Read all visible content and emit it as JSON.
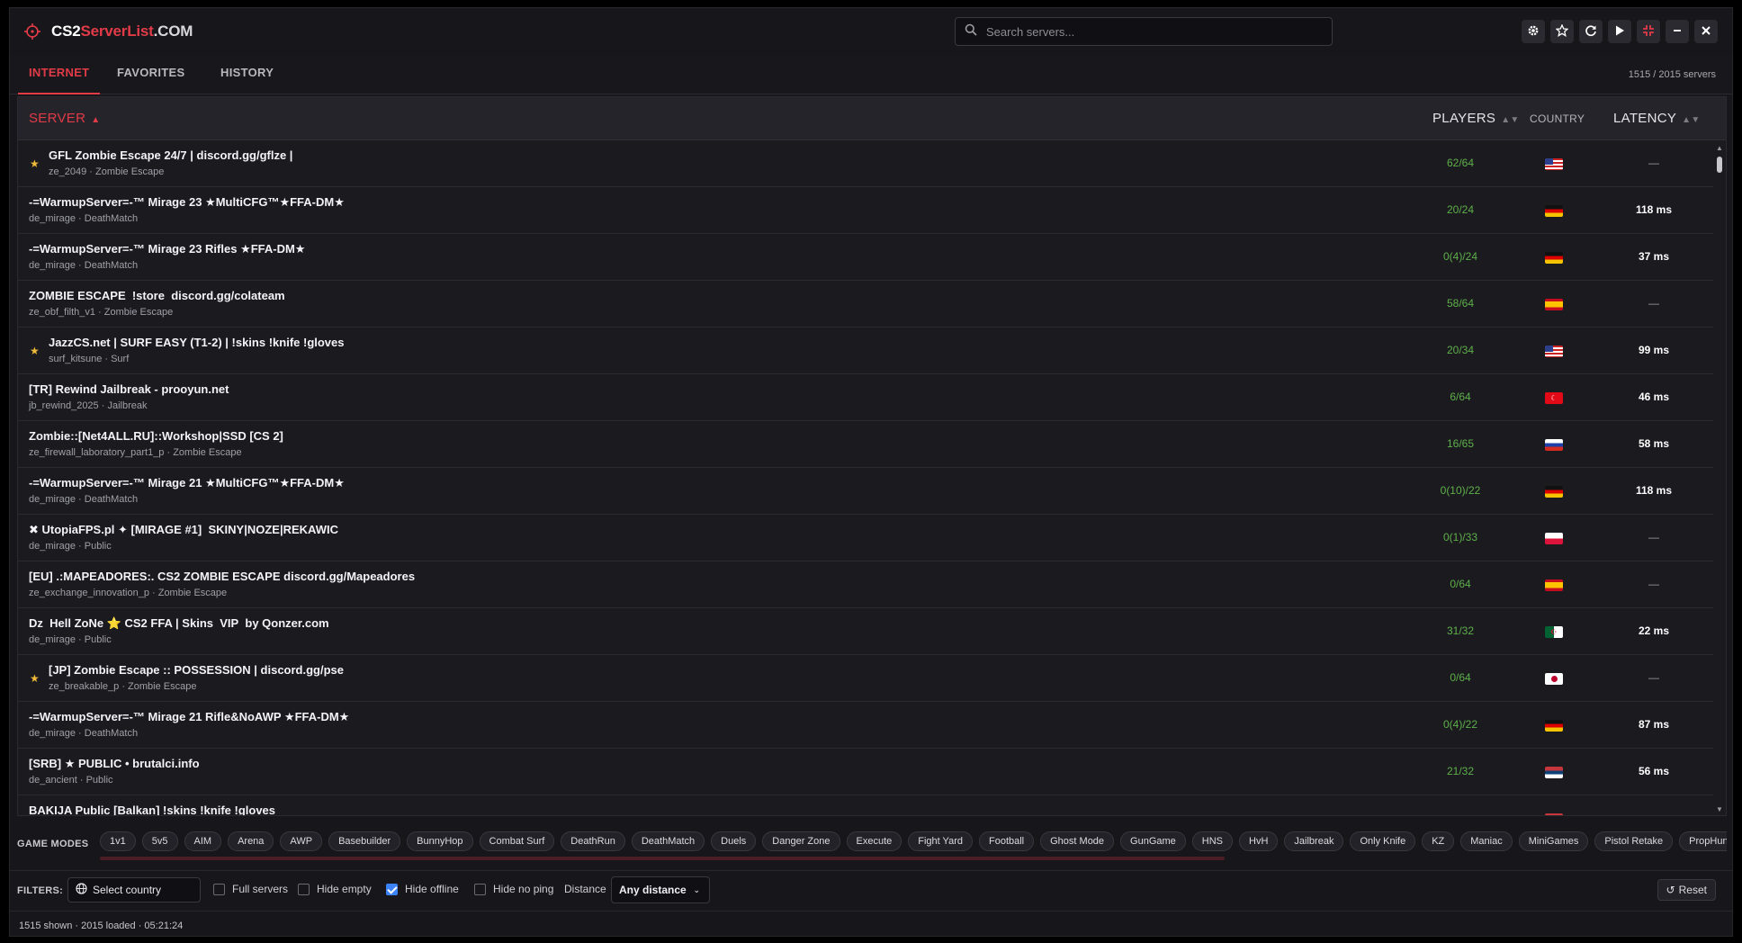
{
  "header": {
    "logo_a": "CS2",
    "logo_b": "ServerList",
    "logo_c": ".COM",
    "search_placeholder": "Search servers...",
    "window_buttons": [
      "settings-icon",
      "star-icon",
      "refresh-icon",
      "play-icon",
      "compress-icon",
      "minimize-icon",
      "close-icon"
    ]
  },
  "tabs": [
    {
      "label": "INTERNET",
      "active": true
    },
    {
      "label": "FAVORITES",
      "active": false
    },
    {
      "label": "HISTORY",
      "active": false
    }
  ],
  "server_count": "1515 / 2015 servers",
  "columns": {
    "server": "SERVER",
    "players": "PLAYERS",
    "country": "COUNTRY",
    "latency": "LATENCY"
  },
  "rows": [
    {
      "fav": true,
      "name": "GFL Zombie Escape 24/7 | discord.gg/gflze |",
      "map": "ze_2049 · Zombie Escape",
      "players": "62/64",
      "country": "US",
      "latency": "—"
    },
    {
      "fav": false,
      "name": "-=WarmupServer=-™ Mirage 23 ★MultiCFG™★FFA-DM★",
      "map": "de_mirage · DeathMatch",
      "players": "20/24",
      "country": "DE",
      "latency": "118 ms"
    },
    {
      "fav": false,
      "name": "-=WarmupServer=-™ Mirage 23 Rifles ★FFA-DM★",
      "map": "de_mirage · DeathMatch",
      "players": "0(4)/24",
      "country": "DE",
      "latency": "37 ms"
    },
    {
      "fav": false,
      "name": "ZOMBIE ESCAPE  !store  discord.gg/colateam",
      "map": "ze_obf_filth_v1 · Zombie Escape",
      "players": "58/64",
      "country": "ES",
      "latency": "—"
    },
    {
      "fav": true,
      "name": "JazzCS.net | SURF EASY (T1-2) | !skins !knife !gloves",
      "map": "surf_kitsune · Surf",
      "players": "20/34",
      "country": "US",
      "latency": "99 ms"
    },
    {
      "fav": false,
      "name": "[TR] Rewind Jailbreak - prooyun.net",
      "map": "jb_rewind_2025 · Jailbreak",
      "players": "6/64",
      "country": "TR",
      "latency": "46 ms"
    },
    {
      "fav": false,
      "name": "Zombie::[Net4ALL.RU]::Workshop|SSD [CS 2]",
      "map": "ze_firewall_laboratory_part1_p · Zombie Escape",
      "players": "16/65",
      "country": "RU",
      "latency": "58 ms"
    },
    {
      "fav": false,
      "name": "-=WarmupServer=-™ Mirage 21 ★MultiCFG™★FFA-DM★",
      "map": "de_mirage · DeathMatch",
      "players": "0(10)/22",
      "country": "DE",
      "latency": "118 ms"
    },
    {
      "fav": false,
      "name": "✖ UtopiaFPS.pl ✦ [MIRAGE #1]  SKINY|NOZE|REKAWIC",
      "map": "de_mirage · Public",
      "players": "0(1)/33",
      "country": "PL",
      "latency": "—"
    },
    {
      "fav": false,
      "name": "[EU] .:MAPEADORES:. CS2 ZOMBIE ESCAPE discord.gg/Mapeadores",
      "map": "ze_exchange_innovation_p · Zombie Escape",
      "players": "0/64",
      "country": "ES",
      "latency": "—"
    },
    {
      "fav": false,
      "name": "Dz  Hell ZoNe ⭐ CS2 FFA | Skins  VIP  by Qonzer.com",
      "map": "de_mirage · Public",
      "players": "31/32",
      "country": "DZ",
      "latency": "22 ms"
    },
    {
      "fav": true,
      "name": "[JP] Zombie Escape :: POSSESSION | discord.gg/pse",
      "map": "ze_breakable_p · Zombie Escape",
      "players": "0/64",
      "country": "JP",
      "latency": "—"
    },
    {
      "fav": false,
      "name": "-=WarmupServer=-™ Mirage 21 Rifle&NoAWP ★FFA-DM★",
      "map": "de_mirage · DeathMatch",
      "players": "0(4)/22",
      "country": "DE",
      "latency": "87 ms"
    },
    {
      "fav": false,
      "name": "[SRB] ★ PUBLIC • brutalci.info",
      "map": "de_ancient · Public",
      "players": "21/32",
      "country": "RS",
      "latency": "56 ms"
    },
    {
      "fav": false,
      "name": "BAKIJA Public [Balkan] !skins !knife !gloves",
      "map": "",
      "players": "",
      "country": "RS",
      "latency": ""
    }
  ],
  "game_modes": {
    "label": "GAME MODES",
    "chips": [
      "1v1",
      "5v5",
      "AIM",
      "Arena",
      "AWP",
      "Basebuilder",
      "BunnyHop",
      "Combat Surf",
      "DeathRun",
      "DeathMatch",
      "Duels",
      "Danger Zone",
      "Execute",
      "Fight Yard",
      "Football",
      "Ghost Mode",
      "GunGame",
      "HNS",
      "HvH",
      "Jailbreak",
      "Only Knife",
      "KZ",
      "Maniac",
      "MiniGames",
      "Pistol Retake",
      "PropHunt"
    ]
  },
  "filters": {
    "label": "FILTERS:",
    "country_placeholder": "Select country",
    "full_servers": "Full servers",
    "hide_empty": "Hide empty",
    "hide_offline": "Hide offline",
    "hide_no_ping": "Hide no ping",
    "distance_label": "Distance",
    "distance_value": "Any distance",
    "reset": "Reset"
  },
  "status": "1515 shown · 2015 loaded · 05:21:24",
  "colors": {
    "accent": "#e23b48",
    "players": "#5fb04a",
    "checkbox": "#3b82f6"
  }
}
